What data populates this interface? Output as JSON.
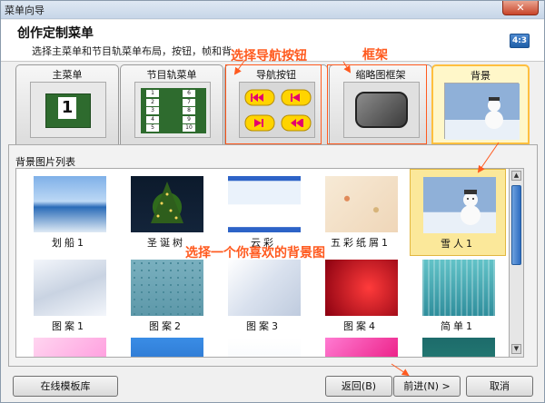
{
  "window": {
    "title": "菜单向导",
    "close": "✕"
  },
  "header": {
    "title": "创作定制菜单",
    "subtitle": "选择主菜单和节目轨菜单布局，按钮，帧和背",
    "ratio": "4:3"
  },
  "tabs": [
    {
      "label": "主菜单",
      "thumb_text": "1"
    },
    {
      "label": "节目轨菜单",
      "thumb_items": [
        "1",
        "2",
        "3",
        "4",
        "5",
        "6",
        "7",
        "8",
        "9",
        "10"
      ]
    },
    {
      "label": "导航按钮"
    },
    {
      "label": "缩略图框架"
    },
    {
      "label": "背景",
      "active": true
    }
  ],
  "list": {
    "label": "背景图片列表",
    "items": [
      {
        "caption": "划船1",
        "kind": "boat"
      },
      {
        "caption": "圣诞树",
        "kind": "tree"
      },
      {
        "caption": "云彩",
        "kind": "clouds"
      },
      {
        "caption": "五彩纸屑1",
        "kind": "confetti"
      },
      {
        "caption": "雪人1",
        "kind": "snowman",
        "selected": true
      },
      {
        "caption": "图案1",
        "kind": "pattern1"
      },
      {
        "caption": "图案2",
        "kind": "pattern2"
      },
      {
        "caption": "图案3",
        "kind": "pattern3"
      },
      {
        "caption": "图案4",
        "kind": "pattern4"
      },
      {
        "caption": "简单1",
        "kind": "simple1"
      },
      {
        "caption": "",
        "kind": "pink"
      },
      {
        "caption": "",
        "kind": "blue"
      },
      {
        "caption": "",
        "kind": "white"
      },
      {
        "caption": "",
        "kind": "magenta"
      },
      {
        "caption": "",
        "kind": "dark"
      }
    ]
  },
  "annotations": {
    "nav": "选择导航按钮",
    "frame": "框架",
    "bg": "选择一个你喜欢的背景图"
  },
  "buttons": {
    "online": "在线模板库",
    "back": "返回(B)",
    "next": "前进(N) >",
    "cancel": "取消"
  },
  "colors": {
    "accent": "#ff5a1f",
    "selected": "#fbe89a"
  }
}
